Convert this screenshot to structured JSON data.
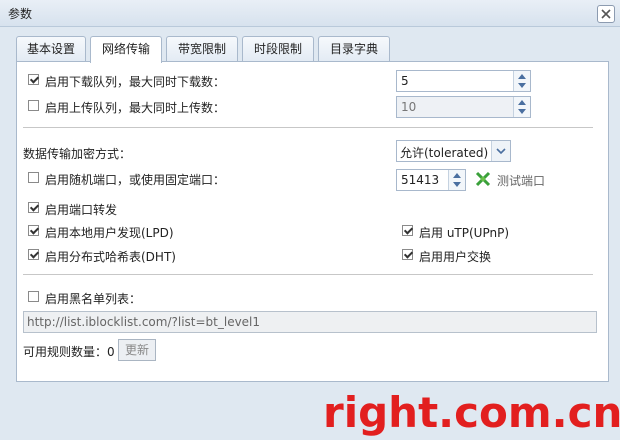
{
  "window": {
    "title": "参数"
  },
  "tabs": [
    {
      "label": "基本设置"
    },
    {
      "label": "网络传输"
    },
    {
      "label": "带宽限制"
    },
    {
      "label": "时段限制"
    },
    {
      "label": "目录字典"
    }
  ],
  "queue": {
    "download_label": "启用下载队列，最大同时下载数：",
    "download_checked": true,
    "download_value": "5",
    "upload_label": "启用上传队列，最大同时上传数：",
    "upload_checked": false,
    "upload_value": "10"
  },
  "encryption": {
    "label": "数据传输加密方式：",
    "selected": "允许(tolerated)"
  },
  "port": {
    "random_label": "启用随机端口，或使用固定端口：",
    "random_checked": false,
    "value": "51413",
    "test_label": "测试端口"
  },
  "options": {
    "port_forward": "启用端口转发",
    "lpd": "启用本地用户发现(LPD)",
    "utp": "启用 uTP(UPnP)",
    "dht": "启用分布式哈希表(DHT)",
    "pex": "启用用户交换"
  },
  "blocklist": {
    "label": "启用黑名单列表：",
    "checked": false,
    "url": "http://list.iblocklist.com/?list=bt_level1",
    "rules_label": "可用规则数量：0",
    "update_label": "更新"
  },
  "watermark": "right.com.cn",
  "colors": {
    "accent": "#4a6fa0",
    "watermark": "#e21f1f",
    "test_icon": "#3aa03a"
  }
}
